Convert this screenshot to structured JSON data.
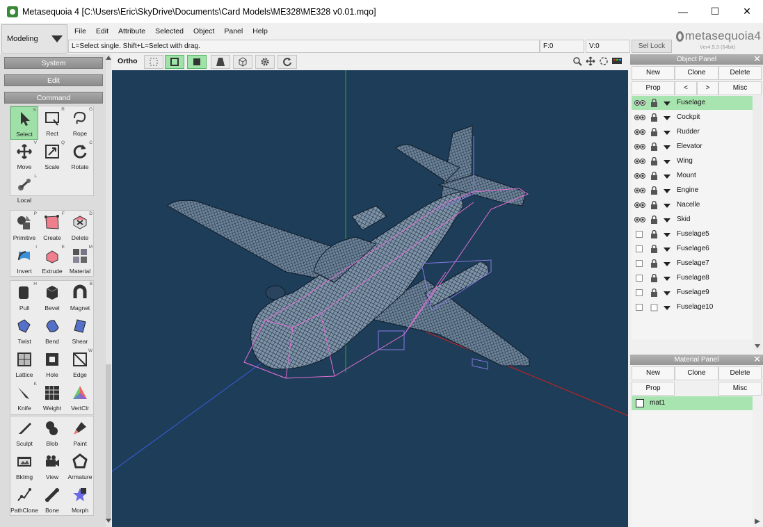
{
  "window": {
    "title": "Metasequoia 4 [C:\\Users\\Eric\\SkyDrive\\Documents\\Card Models\\ME328\\ME328 v0.01.mqo]",
    "minimize": "—",
    "maximize": "☐",
    "close": "✕"
  },
  "mode": {
    "value": "Modeling"
  },
  "menu": [
    "File",
    "Edit",
    "Attribute",
    "Selected",
    "Object",
    "Panel",
    "Help"
  ],
  "status": {
    "hint": "L=Select single.  Shift+L=Select with drag.",
    "faces": "F:0",
    "vertices": "V:0",
    "sel_lock": "Sel Lock"
  },
  "logo": {
    "name": "metasequoia4",
    "version": "Ver4.5.3 (64bit)"
  },
  "left": {
    "system": "System",
    "edit": "Edit",
    "command": "Command",
    "groups": [
      [
        {
          "label": "Select",
          "key": "S",
          "icon": "arrow-cursor-icon",
          "active": true
        },
        {
          "label": "Rect",
          "key": "R",
          "icon": "rect-select-icon"
        },
        {
          "label": "Rope",
          "key": "G",
          "icon": "rope-select-icon"
        },
        {
          "label": "Move",
          "key": "V",
          "icon": "move-icon"
        },
        {
          "label": "Scale",
          "key": "Q",
          "icon": "scale-icon"
        },
        {
          "label": "Rotate",
          "key": "C",
          "icon": "rotate-icon"
        },
        {
          "label": "Local",
          "key": "L",
          "icon": "local-axis-icon"
        }
      ],
      [
        {
          "label": "Primitive",
          "key": "P",
          "icon": "primitive-icon"
        },
        {
          "label": "Create",
          "key": "F",
          "icon": "create-face-icon"
        },
        {
          "label": "Delete",
          "key": "D",
          "icon": "delete-icon"
        },
        {
          "label": "Invert",
          "key": "I",
          "icon": "invert-icon"
        },
        {
          "label": "Extrude",
          "key": "E",
          "icon": "extrude-icon"
        },
        {
          "label": "Material",
          "key": "M",
          "icon": "material-icon"
        }
      ],
      [
        {
          "label": "Pull",
          "key": "H",
          "icon": "pull-icon"
        },
        {
          "label": "Bevel",
          "key": "",
          "icon": "bevel-icon"
        },
        {
          "label": "Magnet",
          "key": "B",
          "icon": "magnet-icon"
        },
        {
          "label": "Twist",
          "key": "",
          "icon": "twist-icon"
        },
        {
          "label": "Bend",
          "key": "",
          "icon": "bend-icon"
        },
        {
          "label": "Shear",
          "key": "",
          "icon": "shear-icon"
        },
        {
          "label": "Lattice",
          "key": "",
          "icon": "lattice-icon"
        },
        {
          "label": "Hole",
          "key": "",
          "icon": "hole-icon"
        },
        {
          "label": "Edge",
          "key": "W",
          "icon": "edge-icon"
        },
        {
          "label": "Knife",
          "key": "K",
          "icon": "knife-icon"
        },
        {
          "label": "Weight",
          "key": "",
          "icon": "weight-icon"
        },
        {
          "label": "VertClr",
          "key": "",
          "icon": "vertex-color-icon"
        }
      ],
      [
        {
          "label": "Sculpt",
          "key": "",
          "icon": "sculpt-icon"
        },
        {
          "label": "Blob",
          "key": "",
          "icon": "blob-icon"
        },
        {
          "label": "Paint",
          "key": "",
          "icon": "paint-icon"
        },
        {
          "label": "BkImg",
          "key": "",
          "icon": "background-image-icon"
        },
        {
          "label": "View",
          "key": "",
          "icon": "camera-icon"
        },
        {
          "label": "Armature",
          "key": "",
          "icon": "armature-icon"
        },
        {
          "label": "PathClone",
          "key": "",
          "icon": "path-clone-icon"
        },
        {
          "label": "Bone",
          "key": "",
          "icon": "bone-icon"
        },
        {
          "label": "Morph",
          "key": "",
          "icon": "morph-icon"
        }
      ]
    ]
  },
  "viewport": {
    "projection": "Ortho"
  },
  "object_panel": {
    "title": "Object Panel",
    "buttons": [
      "New",
      "Clone",
      "Delete",
      "Prop",
      "<",
      ">",
      "Misc"
    ],
    "objects": [
      {
        "name": "Fuselage",
        "visible": true,
        "selected": true
      },
      {
        "name": "Cockpit",
        "visible": true
      },
      {
        "name": "Rudder",
        "visible": true
      },
      {
        "name": "Elevator",
        "visible": true
      },
      {
        "name": "Wing",
        "visible": true
      },
      {
        "name": "Mount",
        "visible": true
      },
      {
        "name": "Engine",
        "visible": true
      },
      {
        "name": "Nacelle",
        "visible": true
      },
      {
        "name": "Skid",
        "visible": true
      },
      {
        "name": "Fuselage5",
        "visible": false
      },
      {
        "name": "Fuselage6",
        "visible": false
      },
      {
        "name": "Fuselage7",
        "visible": false
      },
      {
        "name": "Fuselage8",
        "visible": false
      },
      {
        "name": "Fuselage9",
        "visible": false
      },
      {
        "name": "Fuselage10",
        "visible": false,
        "unlocked": true
      }
    ]
  },
  "material_panel": {
    "title": "Material Panel",
    "buttons": [
      "New",
      "Clone",
      "Delete",
      "Prop",
      "Misc"
    ],
    "materials": [
      {
        "name": "mat1"
      }
    ]
  }
}
